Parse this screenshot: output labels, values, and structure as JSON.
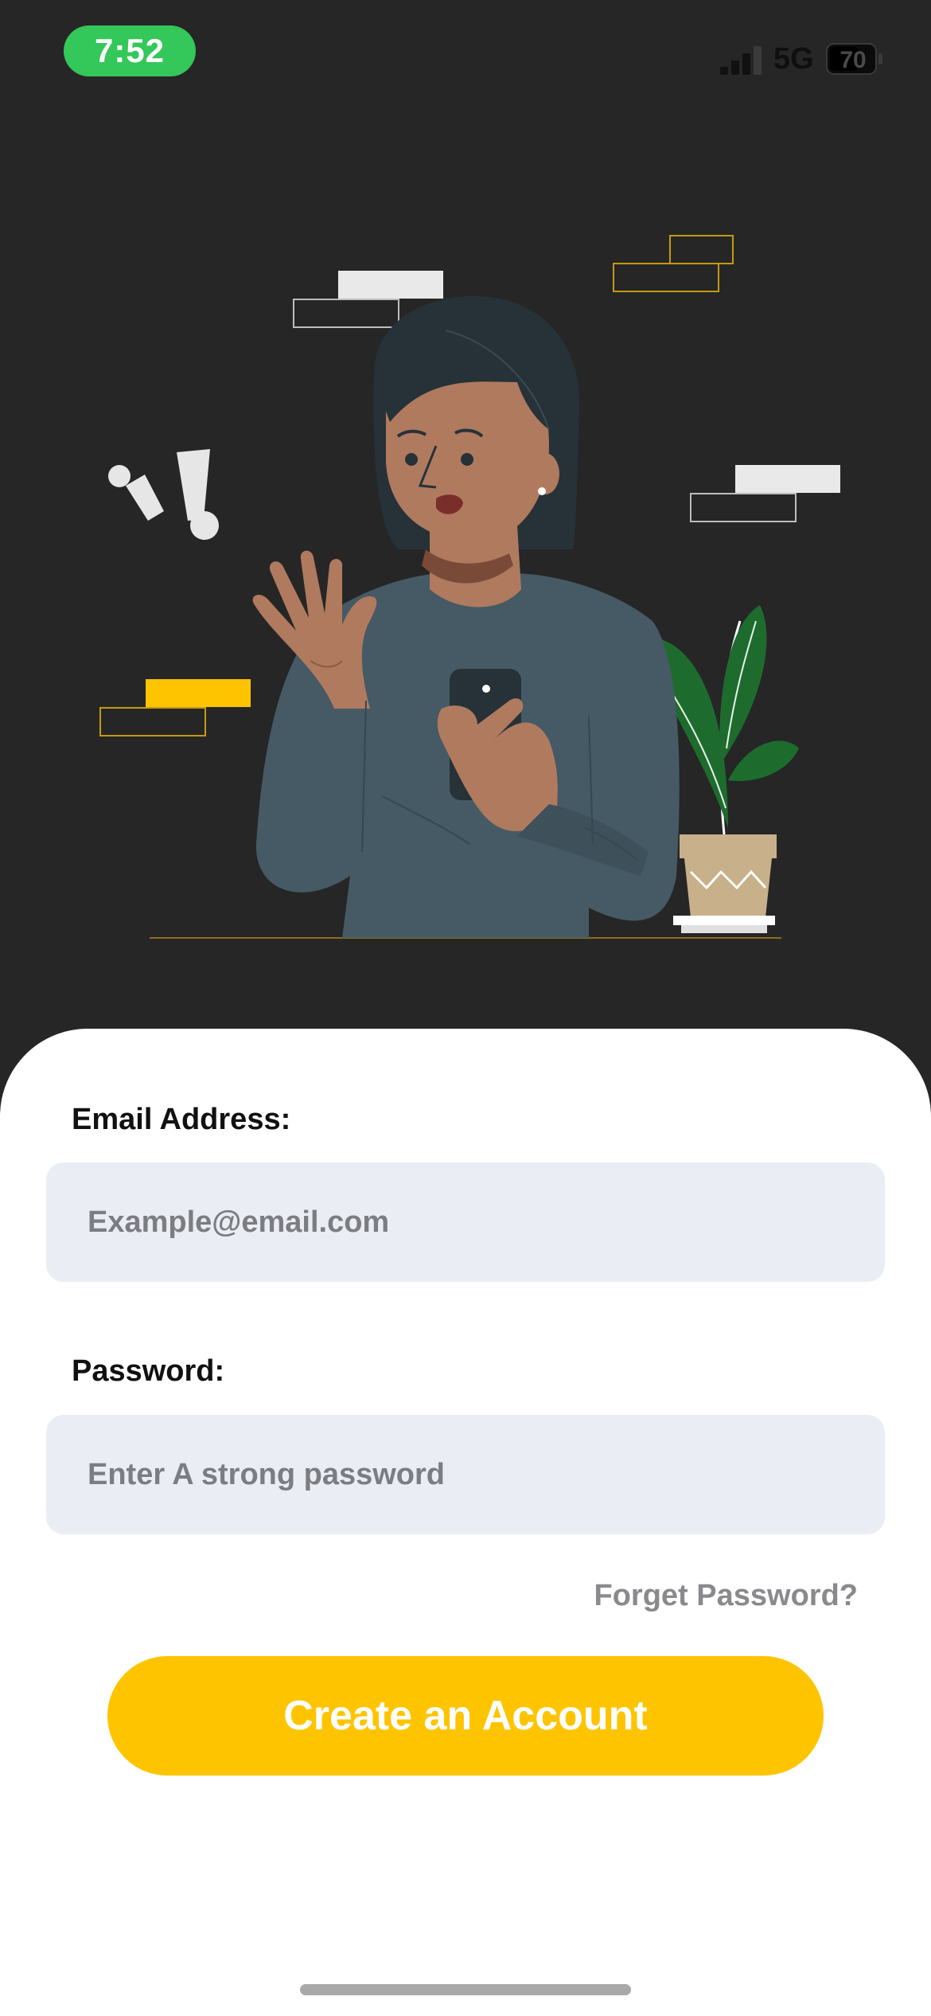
{
  "status_bar": {
    "time": "7:52",
    "network": "5G",
    "battery": "70",
    "battery_level": 0.7,
    "signal_bars": 3,
    "icons": [
      "signal-icon",
      "battery-icon"
    ]
  },
  "illustration": {
    "icon": "person-waving-with-phone-illustration"
  },
  "form": {
    "email_label": "Email Address:",
    "email_placeholder": "Example@email.com",
    "email_value": "",
    "password_label": "Password:",
    "password_placeholder": "Enter A strong password",
    "password_value": "",
    "forgot_label": "Forget Password?",
    "submit_label": "Create an Account"
  },
  "colors": {
    "background": "#262626",
    "accent": "#ffc400",
    "status_pill": "#34c759",
    "input_bg": "#eaedf4",
    "card": "#ffffff"
  }
}
